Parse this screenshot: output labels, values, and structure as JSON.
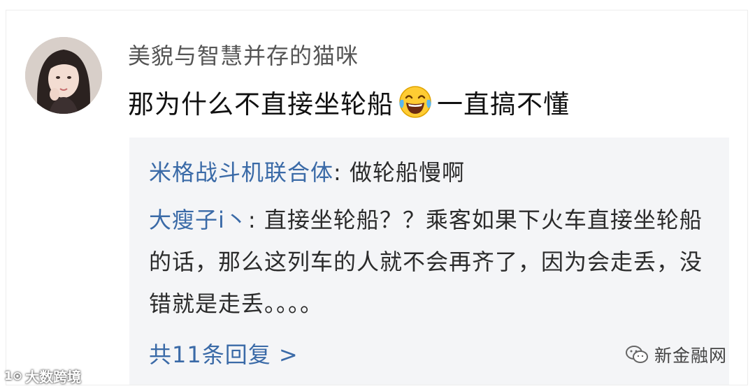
{
  "comment": {
    "username": "美貌与智慧并存的猫咪",
    "text_before_emoji": "那为什么不直接坐轮船",
    "emoji": "laughing-tears-emoji",
    "text_after_emoji": "一直搞不懂"
  },
  "replies": [
    {
      "author": "米格战斗机联合体",
      "separator": ": ",
      "text": "做轮船慢啊"
    },
    {
      "author": "大瘦子i丶",
      "separator": ": ",
      "text": "直接坐轮船？？乘客如果下火车直接坐轮船的话，那么这列车的人就不会再齐了，因为会走丢，没错就是走丢。。。。"
    }
  ],
  "more_replies": "共11条回复 >",
  "watermarks": {
    "left_logo": "1⊙",
    "left_text": "大数跨境",
    "right_text": "新金融网"
  },
  "colors": {
    "link": "#3a6aa7",
    "reply_background": "#f4f5f7",
    "username": "#555555"
  }
}
